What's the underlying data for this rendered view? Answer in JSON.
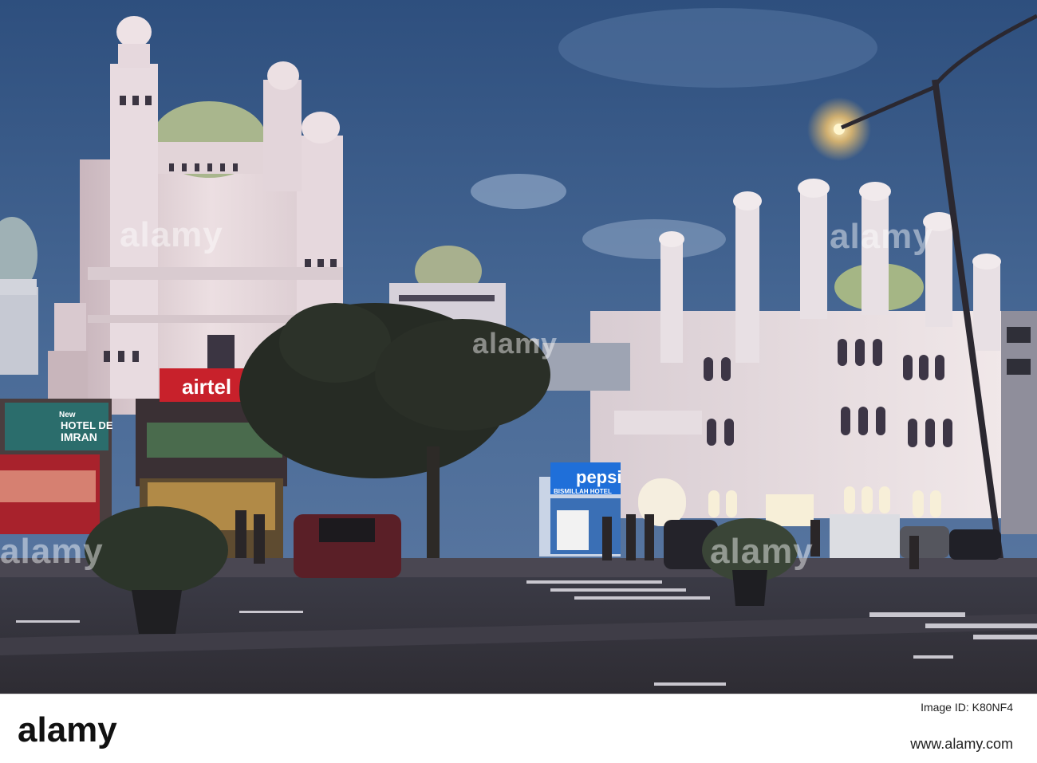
{
  "signs": {
    "airtel": "airtel",
    "hotel_new": "New",
    "hotel_name_1": "HOTEL DE",
    "hotel_name_2": "IMRAN",
    "pepsi": "pepsi",
    "pepsi_sub": "BISMILLAH HOTEL"
  },
  "watermark": {
    "text": "alamy"
  },
  "footer": {
    "logo": "alamy",
    "image_id": "Image ID: K80NF4",
    "url": "www.alamy.com"
  },
  "colors": {
    "sky": "#3e5f8c",
    "building": "#e9dcdc",
    "airtel_red": "#c8212b",
    "pepsi_blue": "#1a6ad6",
    "road": "#3a3a44"
  }
}
